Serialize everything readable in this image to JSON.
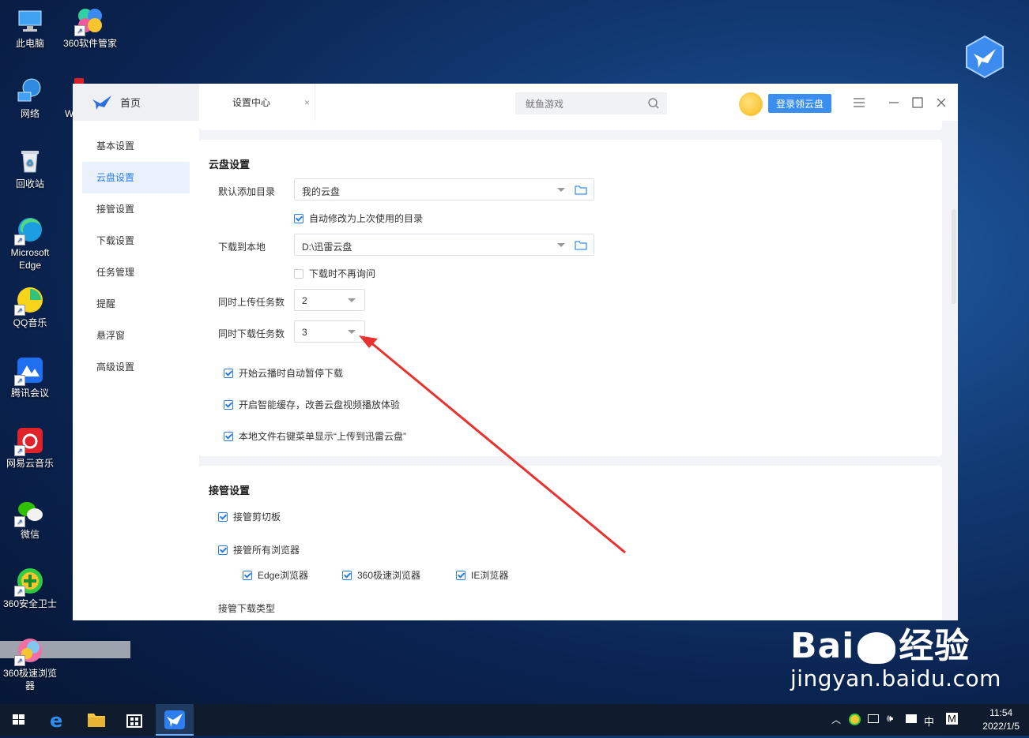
{
  "desktop": {
    "icons": [
      {
        "label": "此电脑"
      },
      {
        "label": "360软件管家"
      },
      {
        "label": "网络"
      },
      {
        "label": "回收站"
      },
      {
        "label": "Microsoft Edge"
      },
      {
        "label": "QQ音乐"
      },
      {
        "label": "腾讯会议"
      },
      {
        "label": "网易云音乐"
      },
      {
        "label": "微信"
      },
      {
        "label": "360安全卫士"
      },
      {
        "label": "360极速浏览器"
      }
    ],
    "partial_label": "W"
  },
  "app": {
    "tabs": {
      "home": "首页",
      "settings": "设置中心",
      "close": "×"
    },
    "search_placeholder": "鱿鱼游戏",
    "login_label": "登录领云盘",
    "sidebar": [
      {
        "label": "基本设置"
      },
      {
        "label": "云盘设置"
      },
      {
        "label": "接管设置"
      },
      {
        "label": "下载设置"
      },
      {
        "label": "任务管理"
      },
      {
        "label": "提醒"
      },
      {
        "label": "悬浮窗"
      },
      {
        "label": "高级设置"
      }
    ],
    "cloud": {
      "title": "云盘设置",
      "default_dir_label": "默认添加目录",
      "default_dir_value": "我的云盘",
      "auto_modify": "自动修改为上次使用的目录",
      "download_local_label": "下载到本地",
      "download_local_value": "D:\\迅雷云盘",
      "no_ask": "下载时不再询问",
      "upload_tasks_label": "同时上传任务数",
      "upload_tasks_value": "2",
      "download_tasks_label": "同时下载任务数",
      "download_tasks_value": "3",
      "opt1": "开始云播时自动暂停下载",
      "opt2": "开启智能缓存，改善云盘视频播放体验",
      "opt3": "本地文件右键菜单显示“上传到迅雷云盘”"
    },
    "takeover": {
      "title": "接管设置",
      "clipboard": "接管剪切板",
      "all_browsers": "接管所有浏览器",
      "edge": "Edge浏览器",
      "speed360": "360极速浏览器",
      "ie": "IE浏览器",
      "types_label": "接管下载类型"
    }
  },
  "watermark": {
    "brand_a": "Bai",
    "brand_b": "经验",
    "url": "jingyan.baidu.com"
  },
  "taskbar": {
    "time": "11:54",
    "date": "2022/1/5",
    "ime": "中",
    "ime2": "M"
  },
  "colors": {
    "accent": "#3a8ef0",
    "active_nav_bg": "#e8f1fc",
    "arrow": "#e8322f"
  }
}
